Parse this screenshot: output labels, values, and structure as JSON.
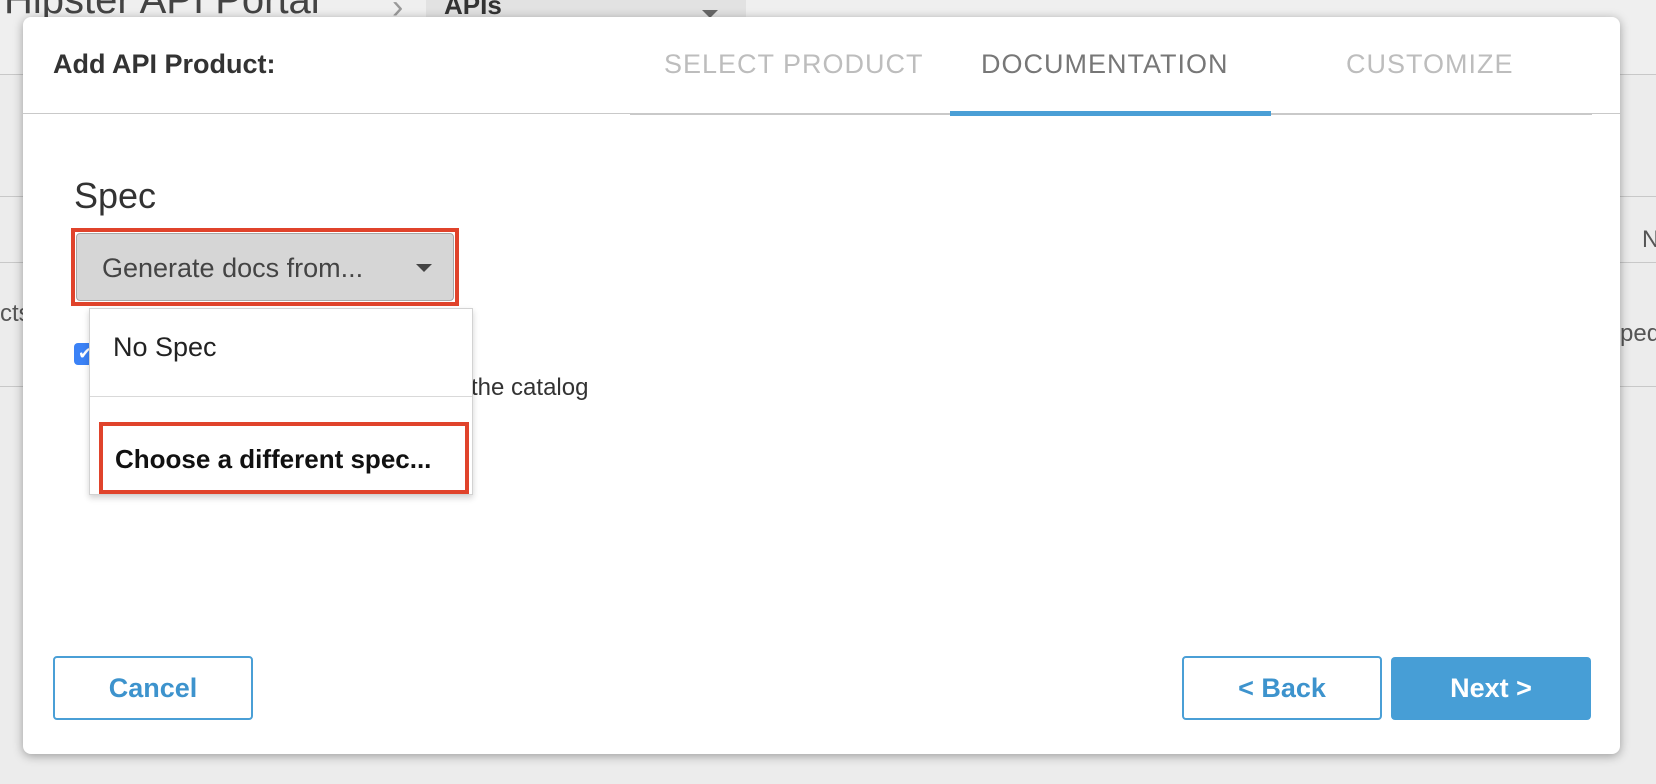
{
  "background": {
    "portal_title": "Hipster API Portal",
    "breadcrumb_separator": "›",
    "section_select": "APIs",
    "row_fragment_left": "cts",
    "row_fragment_right": "ped",
    "column_fragment_right": "N"
  },
  "modal": {
    "title": "Add API Product:",
    "tabs": [
      {
        "label": "SELECT PRODUCT",
        "state": "inactive"
      },
      {
        "label": "DOCUMENTATION",
        "state": "active"
      },
      {
        "label": "CUSTOMIZE",
        "state": "inactive"
      }
    ],
    "spec": {
      "label": "Spec",
      "dropdown_value": "Generate docs from...",
      "menu_items": [
        "No Spec",
        "Choose a different spec..."
      ]
    },
    "checkbox": {
      "checked": true,
      "visible_text": "n the catalog"
    },
    "buttons": {
      "cancel": "Cancel",
      "back": "< Back",
      "next": "Next >"
    }
  },
  "colors": {
    "accent": "#479ed6",
    "highlight": "#e0432b",
    "checkbox": "#3b82f6"
  }
}
